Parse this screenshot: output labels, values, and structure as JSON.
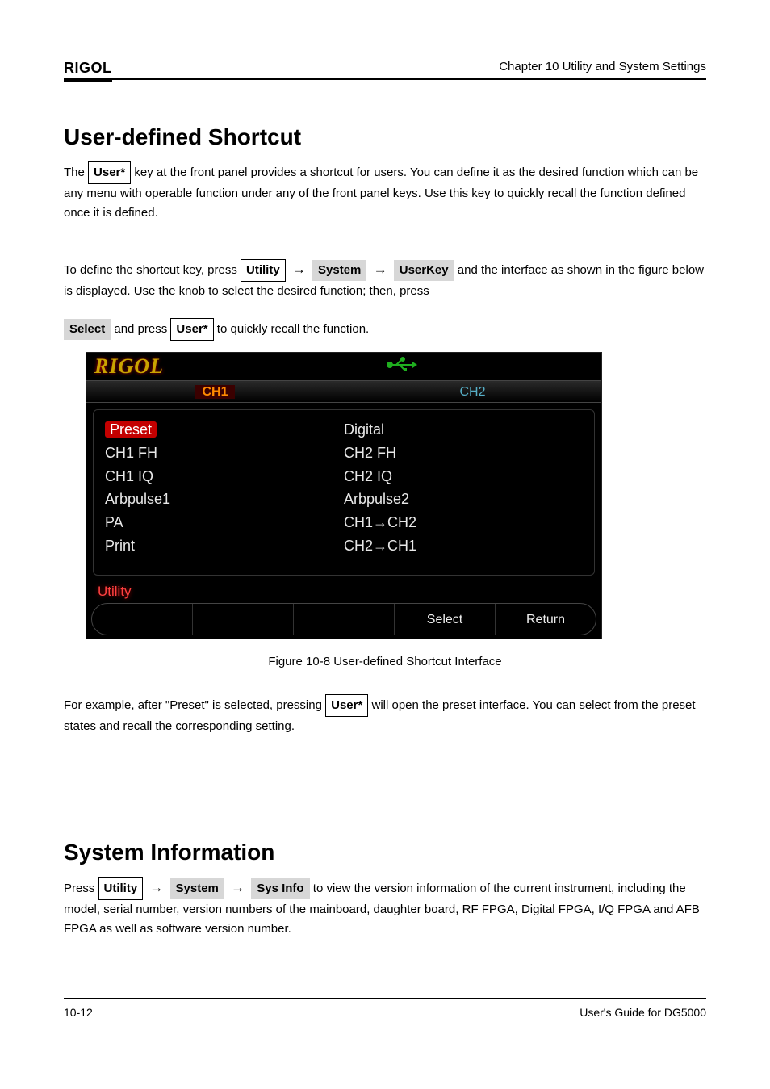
{
  "header": {
    "brand": "RIGOL",
    "chapter": "Chapter 10 Utility and System Settings"
  },
  "section1": {
    "title": "User-defined Shortcut",
    "para1_a": "The ",
    "para1_key": "User*",
    "para1_b": " key at the front panel provides a shortcut for users. You can define it as the desired function which can be any menu with operable function under any of the front panel keys. Use this key to quickly recall the function defined once it is defined.",
    "para2_a": "To define the shortcut key, press ",
    "para2_key_utility": "Utility",
    "para2_soft_system": "System",
    "para2_soft_userkey": "UserKey",
    "para2_b": " and the interface as shown in the figure below is displayed. Use the knob to select the desired function; then, press ",
    "para2_soft_select": "Select",
    "para2_c": " and press ",
    "para2_key_user": "User*",
    "para2_d": " to quickly recall the function."
  },
  "device": {
    "logo": "RIGOL",
    "ch1": "CH1",
    "ch2": "CH2",
    "col1": [
      "Preset",
      "CH1 FH",
      "CH1 IQ",
      "Arbpulse1",
      "PA",
      "Print"
    ],
    "col2": [
      "Digital",
      "CH2 FH",
      "CH2 IQ",
      "Arbpulse2",
      "CH1→CH2",
      "CH2→CH1"
    ],
    "utility": "Utility",
    "softkeys": [
      "",
      "",
      "",
      "Select",
      "Return"
    ]
  },
  "figure_caption": "Figure 10-8 User-defined Shortcut Interface",
  "para4_a": "For example, after \"Preset\" is selected, pressing ",
  "para4_key": "User*",
  "para4_b": " will open the preset interface. You can select from the preset states and recall the corresponding setting.",
  "section2": {
    "title": "System Information",
    "para_a": "Press ",
    "para_key_utility": "Utility",
    "para_soft_system": "System",
    "para_soft_sysinfo": "Sys Info",
    "para_b": " to view the version information of the current instrument, including the model, serial number, version numbers of the mainboard, daughter board, RF FPGA, Digital FPGA, I/Q FPGA and AFB FPGA as well as software version number."
  },
  "footer": {
    "page": "10-12",
    "text": "User's Guide for DG5000"
  }
}
